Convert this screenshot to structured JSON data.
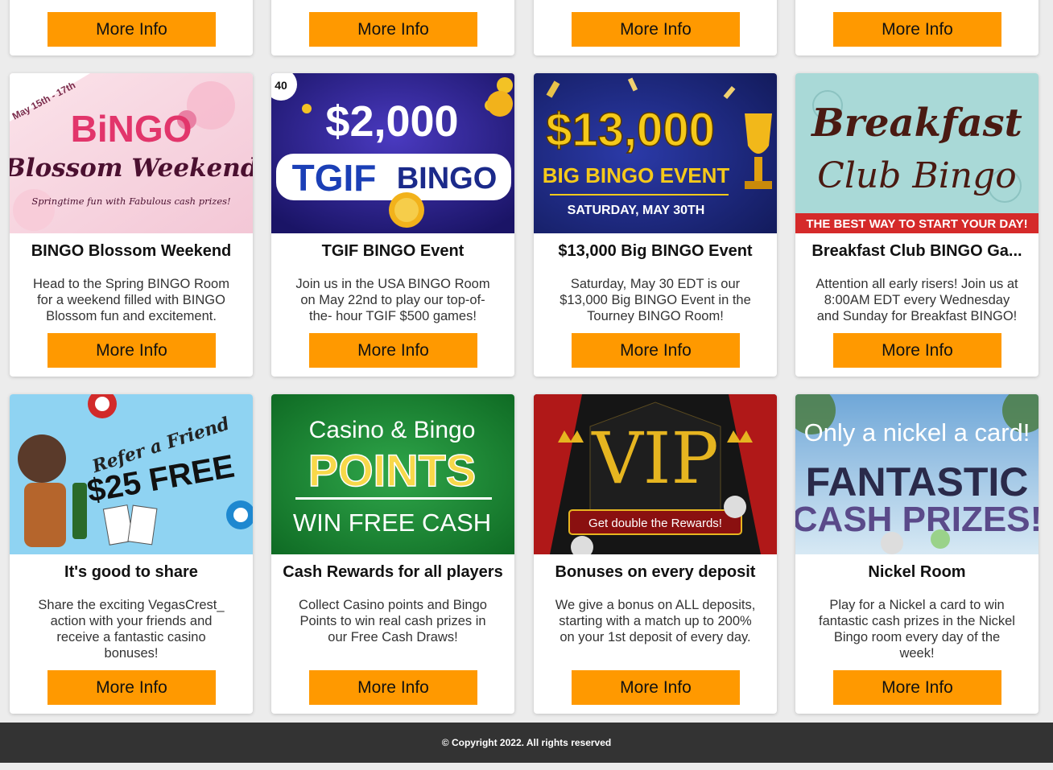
{
  "cards": [
    {
      "button": "More Info"
    },
    {
      "button": "More Info"
    },
    {
      "button": "More Info"
    },
    {
      "button": "More Info"
    },
    {
      "title": "BINGO Blossom Weekend",
      "desc": "Head to the Spring BINGO Room for a weekend filled with BINGO Blossom fun and excitement.",
      "button": "More Info",
      "banner": {
        "tag": "May 15th - 17th",
        "line1": "BiNGO",
        "line2": "Blossom Weekend",
        "line3": "Springtime fun with Fabulous cash prizes!"
      }
    },
    {
      "title": "TGIF BINGO Event",
      "desc": "Join us in the USA BINGO Room on May 22nd to play our top-of-the- hour TGIF $500 games!",
      "button": "More Info",
      "banner": {
        "line1": "$2,000",
        "line2": "TGIF",
        "line3": "BINGO",
        "ball": "40"
      }
    },
    {
      "title": "$13,000 Big BINGO Event",
      "desc": "Saturday, May 30 EDT is our $13,000 Big BINGO Event in the Tourney BINGO Room!",
      "button": "More Info",
      "banner": {
        "line1": "$13,000",
        "line2": "BIG BINGO EVENT",
        "line3": "SATURDAY, MAY 30TH"
      }
    },
    {
      "title": "Breakfast Club BINGO Ga...",
      "desc": "Attention all early risers! Join us at 8:00AM EDT every Wednesday and Sunday for Breakfast BINGO!",
      "button": "More Info",
      "banner": {
        "line1": "Breakfast",
        "line2": "Club Bingo",
        "line3": "THE BEST WAY TO START YOUR DAY!"
      }
    },
    {
      "title": "It's good to share",
      "desc": "Share the exciting VegasCrest_ action with your friends and receive a fantastic casino bonuses!",
      "button": "More Info",
      "banner": {
        "line1": "Refer a Friend",
        "line2": "$25 FREE"
      }
    },
    {
      "title": "Cash Rewards for all players",
      "desc": "Collect Casino points and Bingo Points to win real cash prizes in our Free Cash Draws!",
      "button": "More Info",
      "banner": {
        "line1": "Casino & Bingo",
        "line2": "POINTS",
        "line3": "WIN FREE CASH"
      }
    },
    {
      "title": "Bonuses on every deposit",
      "desc": "We give a bonus on ALL deposits, starting with a match up to 200% on your 1st deposit of every day.",
      "button": "More Info",
      "banner": {
        "line1": "VIP",
        "line2": "Get double the Rewards!"
      }
    },
    {
      "title": "Nickel Room",
      "desc": "Play for a Nickel a card to win fantastic cash prizes in the Nickel Bingo room every day of the week!",
      "button": "More Info",
      "banner": {
        "line1": "Only a nickel a card!",
        "line2": "FANTASTIC",
        "line3": "CASH PRIZES!"
      }
    }
  ],
  "footer": {
    "text": "© Copyright 2022. All rights reserved"
  },
  "colors": {
    "button": "#ff9900",
    "footer": "#333333",
    "background": "#ececec"
  }
}
